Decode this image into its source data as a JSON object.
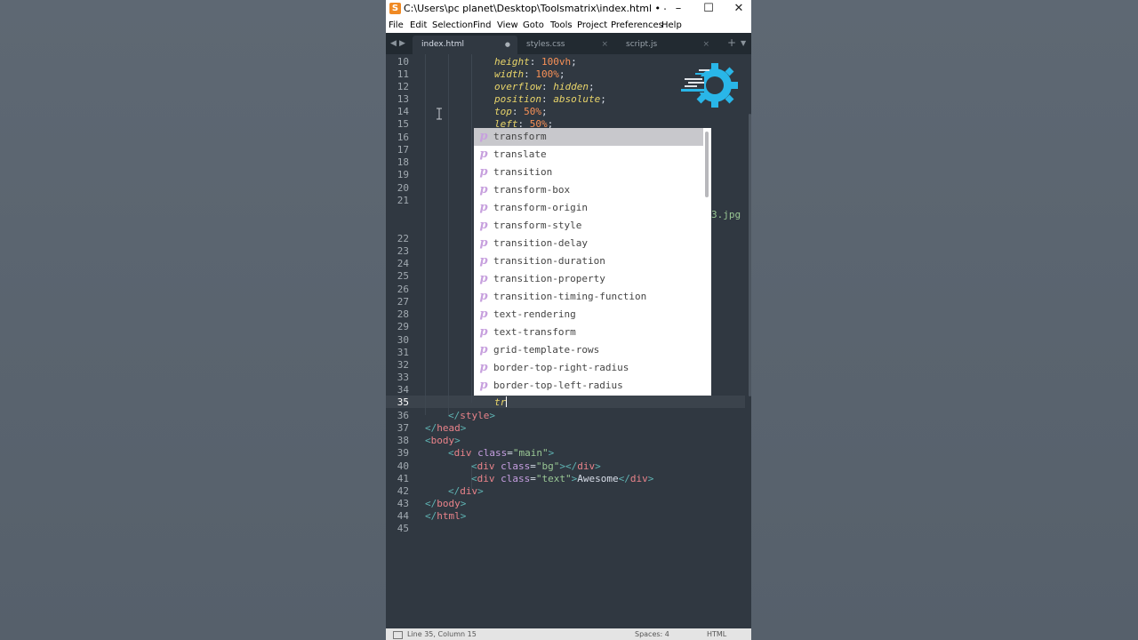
{
  "window": {
    "title": "C:\\Users\\pc planet\\Desktop\\Toolsmatrix\\index.html • - Sublime Text (U...",
    "minimize_glyph": "–",
    "maximize_glyph": "☐",
    "close_glyph": "✕"
  },
  "menu": [
    "File",
    "Edit",
    "Selection",
    "Find",
    "View",
    "Goto",
    "Tools",
    "Project",
    "Preferences",
    "Help"
  ],
  "tabs": [
    {
      "label": "index.html",
      "close_glyph": "●"
    },
    {
      "label": "styles.css",
      "close_glyph": "×"
    },
    {
      "label": "script.js",
      "close_glyph": "×"
    }
  ],
  "tab_controls": {
    "prev": "◀",
    "next": "▶",
    "new": "+",
    "menu": "▼"
  },
  "gutter": [
    "10",
    "11",
    "12",
    "13",
    "14",
    "15",
    "16",
    "17",
    "18",
    "19",
    "20",
    "21",
    "22",
    "23",
    "24",
    "25",
    "26",
    "27",
    "28",
    "29",
    "30",
    "31",
    "32",
    "33",
    "34",
    "35",
    "36",
    "37",
    "38",
    "39",
    "40",
    "41",
    "42",
    "43",
    "44",
    "45"
  ],
  "current_line": "35",
  "code": {
    "l10": {
      "prop": "height",
      "colon": ": ",
      "val": "100vh",
      "semi": ";"
    },
    "l11": {
      "prop": "width",
      "colon": ": ",
      "val": "100%",
      "semi": ";"
    },
    "l12": {
      "prop": "overflow",
      "colon": ": ",
      "val": "hidden",
      "semi": ";"
    },
    "l13": {
      "prop": "position",
      "colon": ": ",
      "val": "absolute",
      "semi": ";"
    },
    "l14": {
      "prop": "top",
      "colon": ": ",
      "val": "50%",
      "semi": ";"
    },
    "l15": {
      "prop": "left",
      "colon": ": ",
      "val": "50%",
      "semi": ";"
    },
    "l35": {
      "typed": "tr"
    },
    "l36": {
      "open": "</",
      "tag": "style",
      "close": ">"
    },
    "l37": {
      "open": "</",
      "tag": "head",
      "close": ">"
    },
    "l38": {
      "open": "<",
      "tag": "body",
      "close": ">"
    },
    "l39": {
      "open": "<",
      "tag": "div",
      "attr": " class",
      "eq": "=",
      "str": "\"main\"",
      "close": ">"
    },
    "l40": {
      "open": "<",
      "tag": "div",
      "attr": " class",
      "eq": "=",
      "str": "\"bg\"",
      "mid": "></",
      "tag2": "div",
      "close": ">"
    },
    "l41": {
      "open": "<",
      "tag": "div",
      "attr": " class",
      "eq": "=",
      "str": "\"text\"",
      "mid": ">",
      "text": "Awesome",
      "open2": "</",
      "tag2": "div",
      "close": ">"
    },
    "l42": {
      "open": "</",
      "tag": "div",
      "close": ">"
    },
    "l43": {
      "open": "</",
      "tag": "body",
      "close": ">"
    },
    "l44": {
      "open": "</",
      "tag": "html",
      "close": ">"
    }
  },
  "partial_behind_popup": {
    "jpg": "3.jpg"
  },
  "autocomplete": {
    "kind_glyph": "p",
    "items": [
      {
        "label": "transform",
        "selected": true
      },
      {
        "label": "translate"
      },
      {
        "label": "transition"
      },
      {
        "label": "transform-box"
      },
      {
        "label": "transform-origin"
      },
      {
        "label": "transform-style"
      },
      {
        "label": "transition-delay"
      },
      {
        "label": "transition-duration"
      },
      {
        "label": "transition-property"
      },
      {
        "label": "transition-timing-function"
      },
      {
        "label": "text-rendering"
      },
      {
        "label": "text-transform"
      },
      {
        "label": "grid-template-rows"
      },
      {
        "label": "border-top-right-radius"
      },
      {
        "label": "border-top-left-radius"
      }
    ]
  },
  "status": {
    "position": "Line 35, Column 15",
    "spaces": "Spaces: 4",
    "syntax": "HTML"
  },
  "colors": {
    "editor_bg": "#303841",
    "tab_bar_bg": "#222a31",
    "property": "#e9d56a",
    "number": "#f99157",
    "tag": "#e9838a",
    "attribute": "#c59ee0",
    "string": "#99c794",
    "punctuation": "#5fb3b3",
    "logo_accent": "#29b6e8"
  },
  "icons": {
    "app": "sublime-text-icon",
    "logo": "toolsmatrix-gear-logo",
    "cursor": "text-i-beam-cursor"
  }
}
